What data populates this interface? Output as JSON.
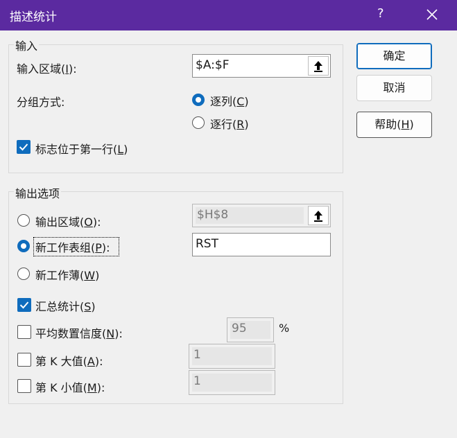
{
  "window": {
    "title": "描述统计",
    "help_glyph": "?",
    "close_glyph": "✕"
  },
  "input_group": {
    "legend": "输入",
    "range_label": "输入区域(I):",
    "range_value": "$A:$F",
    "group_by_label": "分组方式:",
    "by_columns": "逐列(C)",
    "by_rows": "逐行(R)",
    "labels_first_row": "标志位于第一行(L)"
  },
  "output_group": {
    "legend": "输出选项",
    "output_range": "输出区域(O):",
    "output_range_value": "$H$8",
    "new_sheet": "新工作表组(P):",
    "new_sheet_value": "RST",
    "new_workbook": "新工作薄(W)",
    "summary_stats": "汇总统计(S)",
    "confidence": "平均数置信度(N):",
    "confidence_value": "95",
    "percent": "%",
    "kth_largest": "第 K 大值(A):",
    "kth_largest_value": "1",
    "kth_smallest": "第 K 小值(M):",
    "kth_smallest_value": "1"
  },
  "buttons": {
    "ok": "确定",
    "cancel": "取消",
    "help": "帮助(H)"
  },
  "colors": {
    "titlebar": "#5b2aa0",
    "accent": "#0f6cbd"
  },
  "state": {
    "group_by": "columns",
    "output_option": "new_sheet",
    "labels_first_row": true,
    "summary_stats": true,
    "confidence": false,
    "kth_largest": false,
    "kth_smallest": false
  }
}
